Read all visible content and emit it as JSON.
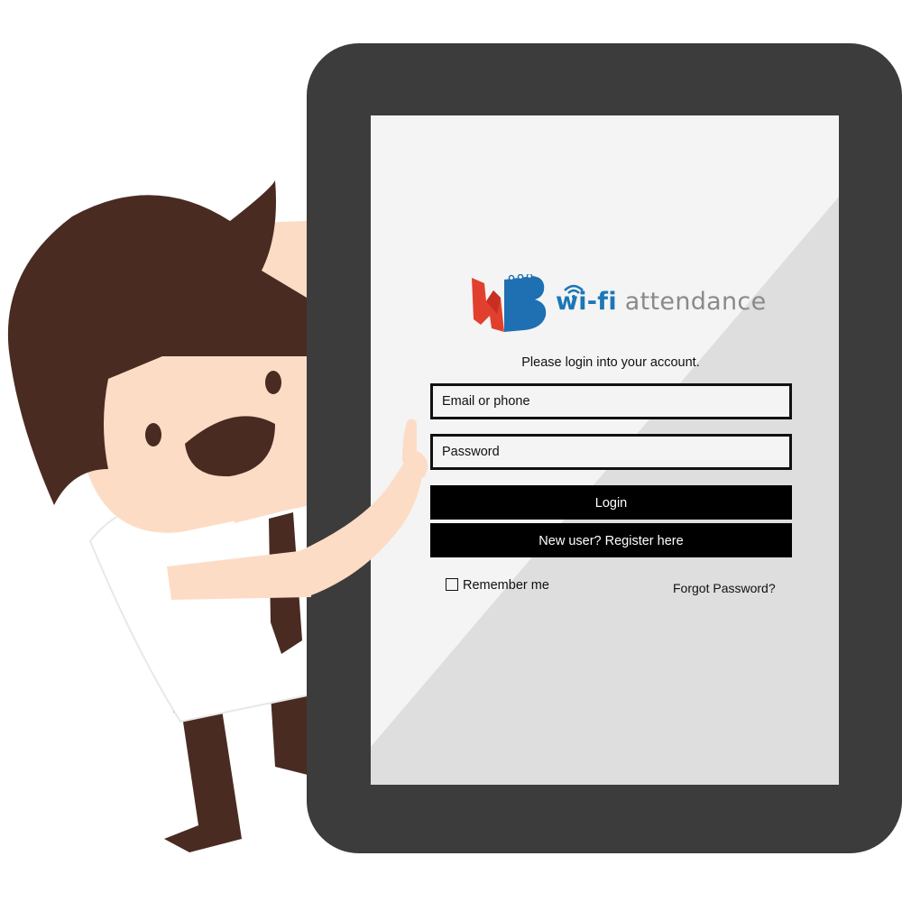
{
  "logo": {
    "wifi_word": "wi-fi",
    "attendance_word": "attendance"
  },
  "login_form": {
    "instruction": "Please login into your account.",
    "email_placeholder": "Email or phone",
    "password_placeholder": "Password",
    "login_label": "Login",
    "register_label": "New user? Register here",
    "remember_label": "Remember me",
    "forgot_label": "Forgot Password?"
  },
  "colors": {
    "tablet_frame": "#3c3c3c",
    "screen": "#f4f4f4",
    "button": "#000000",
    "brand_blue": "#1b77b7",
    "brand_red": "#e2402e",
    "hair": "#4a2b22",
    "skin": "#fddcc6"
  }
}
